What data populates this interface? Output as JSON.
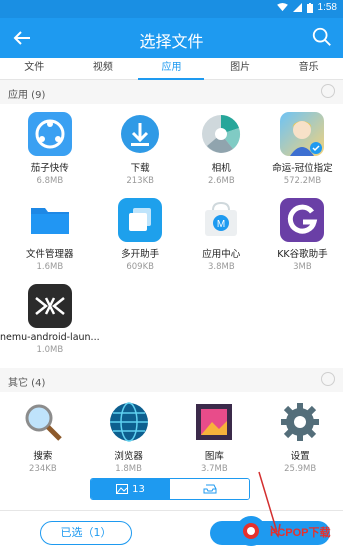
{
  "status_bar": {
    "time": "1:58",
    "icons": [
      "wifi-icon",
      "cell-signal-icon",
      "battery-icon"
    ]
  },
  "header": {
    "title": "选择文件"
  },
  "tabs": [
    {
      "label": "文件",
      "active": false
    },
    {
      "label": "视频",
      "active": false
    },
    {
      "label": "应用",
      "active": true
    },
    {
      "label": "图片",
      "active": false
    },
    {
      "label": "音乐",
      "active": false
    }
  ],
  "apps_section": {
    "label": "应用 (9)"
  },
  "apps": [
    {
      "name": "茄子快传",
      "size": "6.8MB",
      "icon": "share-icon"
    },
    {
      "name": "下载",
      "size": "213KB",
      "icon": "download-icon"
    },
    {
      "name": "相机",
      "size": "2.6MB",
      "icon": "camera-aperture-icon"
    },
    {
      "name": "命运-冠位指定",
      "size": "572.2MB",
      "icon": "game-avatar-icon"
    },
    {
      "name": "文件管理器",
      "size": "1.6MB",
      "icon": "folder-icon"
    },
    {
      "name": "多开助手",
      "size": "609KB",
      "icon": "multi-window-icon"
    },
    {
      "name": "应用中心",
      "size": "3.8MB",
      "icon": "app-store-icon"
    },
    {
      "name": "KK谷歌助手",
      "size": "3MB",
      "icon": "google-helper-icon"
    },
    {
      "name": "nemu-android-laun...",
      "size": "1.0MB",
      "icon": "nemu-logo-icon"
    }
  ],
  "others_section": {
    "label": "其它 (4)"
  },
  "others": [
    {
      "name": "搜索",
      "size": "234KB",
      "icon": "magnifier-icon"
    },
    {
      "name": "浏览器",
      "size": "1.8MB",
      "icon": "globe-icon"
    },
    {
      "name": "图库",
      "size": "3.7MB",
      "icon": "gallery-icon"
    },
    {
      "name": "设置",
      "size": "25.9MB",
      "icon": "gear-icon"
    }
  ],
  "view_switch": {
    "left_count": "13"
  },
  "bottom": {
    "selected_label": "已选（1）"
  },
  "watermark": {
    "text": "PCPOP下载"
  },
  "colors": {
    "primary": "#1e9af0",
    "status_bar": "#1a8fe3",
    "watermark": "#e6312d"
  }
}
